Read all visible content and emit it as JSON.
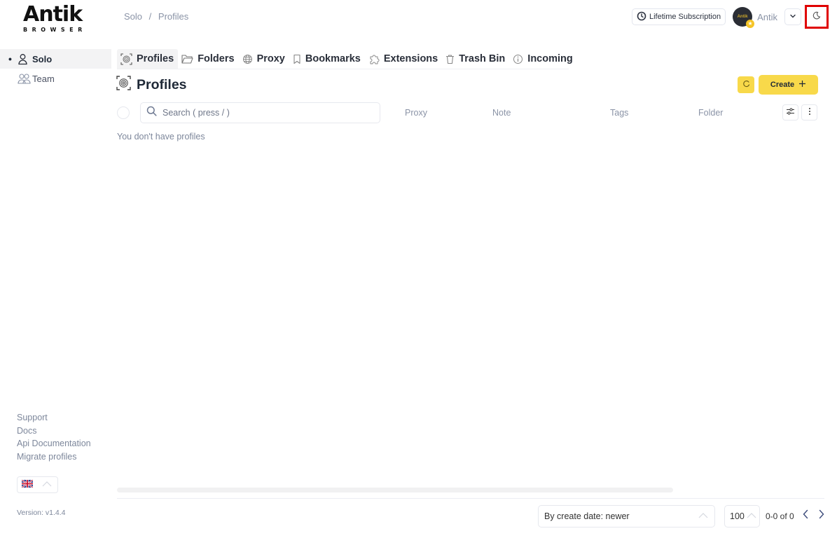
{
  "brand": {
    "name": "Antik",
    "sub": "BROWSER"
  },
  "breadcrumb": [
    "Solo",
    "/",
    "Profiles"
  ],
  "topbar": {
    "subscription_label": "Lifetime Subscription",
    "avatar_text": "Antik",
    "user_name": "Antik",
    "theme_toggle": "moon-icon"
  },
  "sidebar": {
    "items": [
      {
        "label": "Solo",
        "icon": "user-icon",
        "active": true
      },
      {
        "label": "Team",
        "icon": "users-icon",
        "active": false
      }
    ],
    "links": [
      "Support",
      "Docs",
      "Api Documentation",
      "Migrate profiles"
    ],
    "language": "en-GB",
    "version": "Version: v1.4.4"
  },
  "tabs": [
    {
      "label": "Profiles",
      "icon": "fingerprint-icon",
      "active": true
    },
    {
      "label": "Folders",
      "icon": "folder-icon"
    },
    {
      "label": "Proxy",
      "icon": "globe-icon"
    },
    {
      "label": "Bookmarks",
      "icon": "bookmark-icon"
    },
    {
      "label": "Extensions",
      "icon": "puzzle-icon"
    },
    {
      "label": "Trash Bin",
      "icon": "trash-icon"
    },
    {
      "label": "Incoming",
      "icon": "info-icon"
    }
  ],
  "main": {
    "title": "Profiles",
    "create_label": "Create",
    "search_placeholder": "Search ( press / )",
    "search_value": "",
    "columns": [
      "Proxy",
      "Note",
      "Tags",
      "Folder"
    ],
    "empty_message": "You don't have profiles"
  },
  "footer": {
    "sort_value": "By create date: newer",
    "page_size": "100",
    "page_info": "0-0 of 0"
  }
}
